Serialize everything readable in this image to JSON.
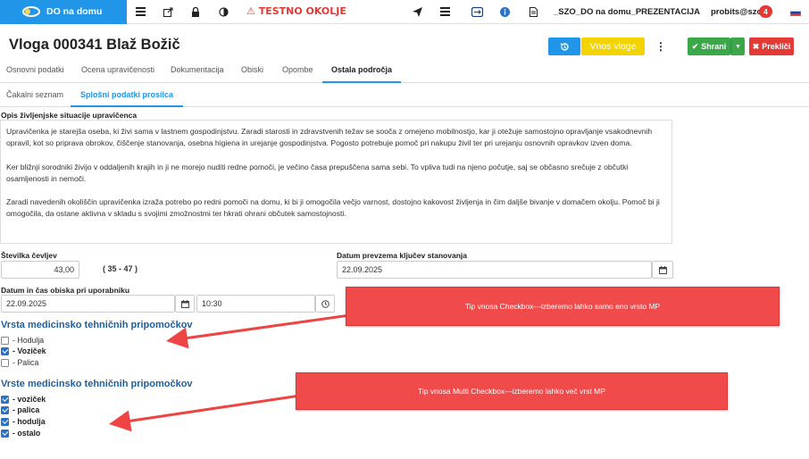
{
  "topbar": {
    "brand": "DO na domu",
    "env_warning": "TESTNO OKOLJE",
    "project": "_SZO_DO na domu_PREZENTACIJA",
    "user": "probits@szo",
    "notifications": "4",
    "icons": [
      "list-icon",
      "external-link-icon",
      "lock-icon",
      "contrast-icon",
      "warning-icon",
      "send-icon",
      "menu-icon",
      "screen-icon",
      "info-icon",
      "document-icon",
      "flag-icon"
    ]
  },
  "page": {
    "title": "Vloga 000341 Blaž Božič",
    "buttons": {
      "vnos": "Vnos vloge",
      "save": "Shrani",
      "cancel": "Prekliči"
    }
  },
  "tabs": [
    {
      "label": "Osnovni podatki",
      "active": false
    },
    {
      "label": "Ocena upravičenosti",
      "active": false
    },
    {
      "label": "Dokumentacija",
      "active": false
    },
    {
      "label": "Obiski",
      "active": false
    },
    {
      "label": "Opombe",
      "active": false
    },
    {
      "label": "Ostala področja",
      "active": true
    }
  ],
  "subtabs": [
    {
      "label": "Čakalni seznam",
      "active": false
    },
    {
      "label": "Splošni podatki prosilca",
      "active": true
    }
  ],
  "situation": {
    "label": "Opis življenjske situacije upravičenca",
    "paragraphs": [
      "Upravičenka je starejša oseba, ki živi sama v lastnem gospodinjstvu. Zaradi starosti in zdravstvenih težav se sooča z omejeno mobilnostjo, kar ji otežuje samostojno opravljanje vsakodnevnih opravil, kot so priprava obrokov, čiščenje stanovanja, osebna higiena in urejanje gospodinjstva. Pogosto potrebuje pomoč pri nakupu živil ter pri urejanju osnovnih opravkov izven doma.",
      "Ker bližnji sorodniki živijo v oddaljenih krajih in ji ne morejo nuditi redne pomoči, je večino časa prepuščena sama sebi. To vpliva tudi na njeno počutje, saj se občasno srečuje z občutki osamljenosti in nemoči.",
      "Zaradi navedenih okoliščin upravičenka izraža potrebo po redni pomoči na domu, ki bi ji omogočila večjo varnost, dostojno kakovost življenja in čim daljše bivanje v domačem okolju. Pomoč bi ji omogočila, da ostane aktivna v skladu s svojimi zmožnostmi ter hkrati ohrani občutek samostojnosti."
    ]
  },
  "fields": {
    "shoe_label": "Številka čevljev",
    "shoe_value": "43,00",
    "shoe_range": "( 35 - 47 )",
    "keys_label": "Datum prevzema ključev stanovanja",
    "keys_value": "22.09.2025",
    "visit_label": "Datum in čas obiska pri uporabniku",
    "visit_date": "22.09.2025",
    "visit_time": "10:30"
  },
  "single_checkbox": {
    "title": "Vrsta medicinsko tehničnih pripomočkov",
    "options": [
      {
        "label": "- Hodulja",
        "checked": false
      },
      {
        "label": "- Voziček",
        "checked": true
      },
      {
        "label": "- Palica",
        "checked": false
      }
    ]
  },
  "multi_checkbox": {
    "title": "Vrste medicinsko tehničnih pripomočkov",
    "options": [
      {
        "label": "- voziček",
        "checked": true
      },
      {
        "label": "- palica",
        "checked": true
      },
      {
        "label": "- hodulja",
        "checked": true
      },
      {
        "label": "- ostalo",
        "checked": true
      }
    ]
  },
  "callouts": {
    "single": "Tip vnosa Checkbox---izberemo lahko samo eno vrsto MP",
    "multi": "Tip vnosa Multi Checkbox---izberemo lahko več vrst  MP"
  }
}
